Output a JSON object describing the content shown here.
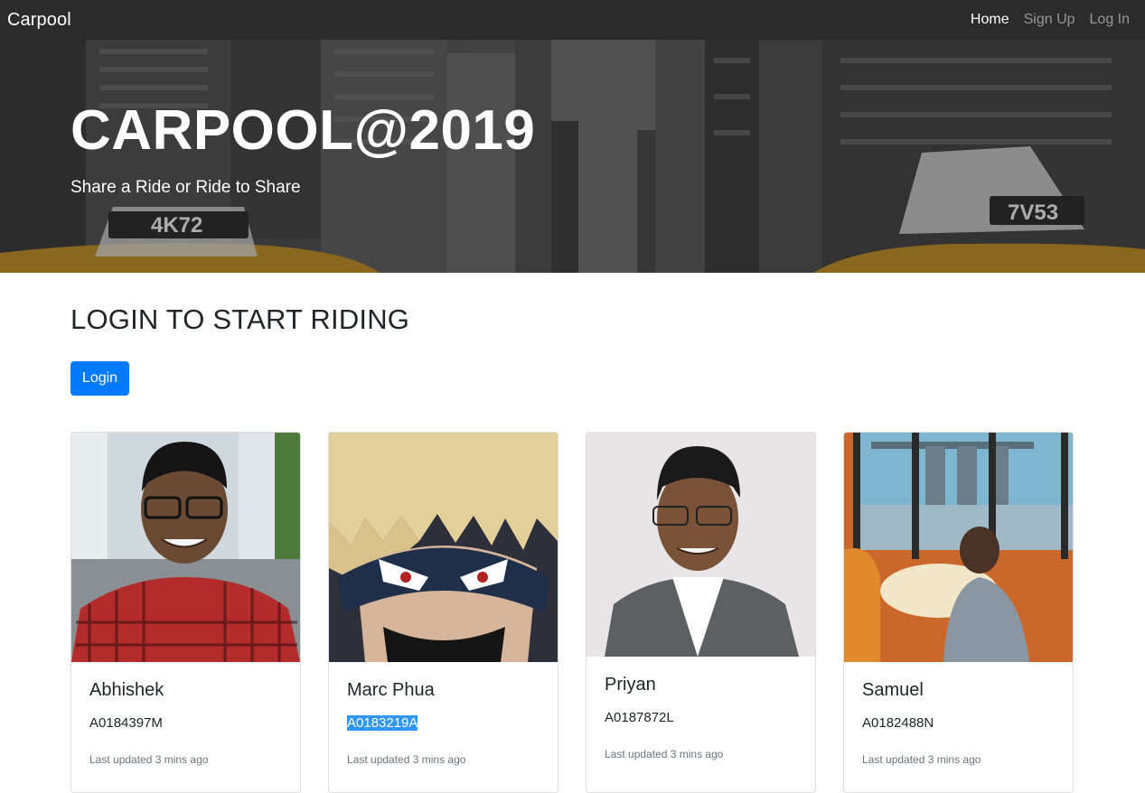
{
  "navbar": {
    "brand": "Carpool",
    "links": [
      {
        "label": "Home",
        "active": true
      },
      {
        "label": "Sign Up",
        "active": false
      },
      {
        "label": "Log In",
        "active": false
      }
    ]
  },
  "hero": {
    "title": "CARPOOL@2019",
    "subtitle": "Share a Ride or Ride to Share",
    "background_signs": [
      "4K72",
      "7V53"
    ]
  },
  "main": {
    "heading": "LOGIN TO START RIDING",
    "login_button": "Login"
  },
  "cards": [
    {
      "name": "Abhishek",
      "id": "A0184397M",
      "updated": "Last updated 3 mins ago"
    },
    {
      "name": "Marc Phua",
      "id": "A0183219A",
      "updated": "Last updated 3 mins ago",
      "id_selected": true
    },
    {
      "name": "Priyan",
      "id": "A0187872L",
      "updated": "Last updated 3 mins ago"
    },
    {
      "name": "Samuel",
      "id": "A0182488N",
      "updated": "Last updated 3 mins ago"
    }
  ],
  "colors": {
    "navbar_bg": "#2b2b2b",
    "primary": "#007bff",
    "selection": "#3297fd",
    "muted_text": "#6c757d"
  }
}
